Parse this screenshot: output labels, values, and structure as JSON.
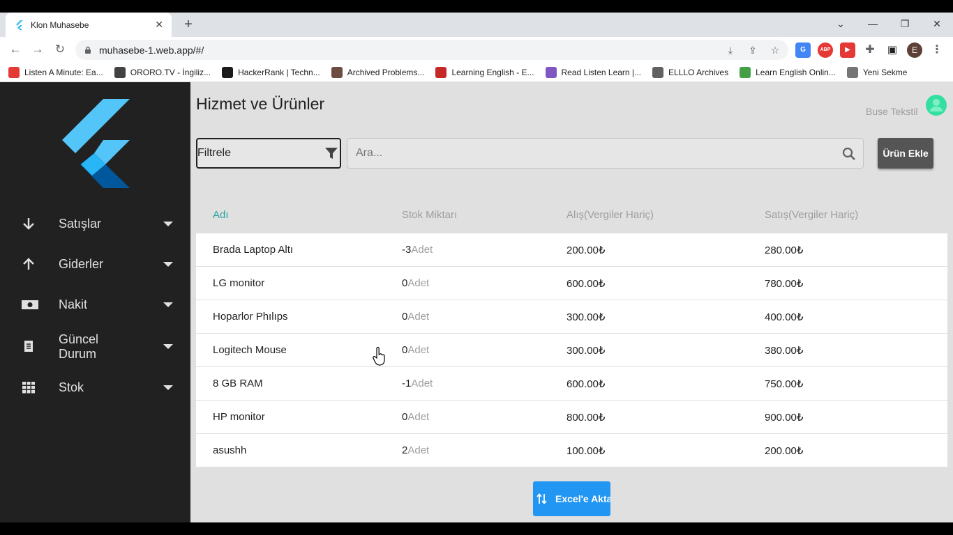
{
  "browser": {
    "tab_title": "Klon Muhasebe",
    "tab_close": "✕",
    "new_tab": "+",
    "url": "muhasebe-1.web.app/#/",
    "profile_initial": "E",
    "bookmarks": [
      {
        "label": "Listen A Minute: Ea...",
        "color": "#e53935"
      },
      {
        "label": "ORORO.TV - İngiliz...",
        "color": "#424242"
      },
      {
        "label": "HackerRank | Techn...",
        "color": "#1b1b1b"
      },
      {
        "label": "Archived Problems...",
        "color": "#6d4c41"
      },
      {
        "label": "Learning English - E...",
        "color": "#c62828"
      },
      {
        "label": "Read Listen Learn |...",
        "color": "#7e57c2"
      },
      {
        "label": "ELLLO Archives",
        "color": "#616161"
      },
      {
        "label": "Learn English Onlin...",
        "color": "#43a047"
      },
      {
        "label": "Yeni Sekme",
        "color": "#757575"
      }
    ]
  },
  "sidebar": {
    "items": [
      {
        "label": "Satışlar",
        "icon": "arrow-down-icon"
      },
      {
        "label": "Giderler",
        "icon": "arrow-up-icon"
      },
      {
        "label": "Nakit",
        "icon": "money-icon"
      },
      {
        "label": "Güncel\nDurum",
        "icon": "receipt-icon"
      },
      {
        "label": "Stok",
        "icon": "grid-icon"
      }
    ]
  },
  "header": {
    "title": "Hizmet ve Ürünler",
    "user_name": "Buse Tekstil"
  },
  "controls": {
    "filter_label": "Filtrele",
    "search_placeholder": "Ara...",
    "add_button": "Ürün Ekle"
  },
  "table": {
    "headers": [
      "Adı",
      "Stok Miktarı",
      "Alış(Vergiler Hariç)",
      "Satış(Vergiler Hariç)"
    ],
    "unit": "Adet",
    "currency": "₺",
    "rows": [
      {
        "name": "Brada Laptop Altı",
        "stock": "-3",
        "buy": "200.00",
        "sell": "280.00"
      },
      {
        "name": "LG monitor",
        "stock": "0",
        "buy": "600.00",
        "sell": "780.00"
      },
      {
        "name": "Hoparlor Phılıps",
        "stock": "0",
        "buy": "300.00",
        "sell": "400.00"
      },
      {
        "name": "Logitech Mouse",
        "stock": "0",
        "buy": "300.00",
        "sell": "380.00"
      },
      {
        "name": "8 GB RAM",
        "stock": "-1",
        "buy": "600.00",
        "sell": "750.00"
      },
      {
        "name": "HP monitor",
        "stock": "0",
        "buy": "800.00",
        "sell": "900.00"
      },
      {
        "name": "asushh",
        "stock": "2",
        "buy": "100.00",
        "sell": "200.00"
      }
    ]
  },
  "footer": {
    "excel_button": "Excel'e Aktar"
  },
  "colors": {
    "sidebar_bg": "#212121",
    "accent_teal": "#26a69a",
    "excel_blue": "#2196f3",
    "flutter_light": "#54c5f8",
    "flutter_dark": "#01579b"
  }
}
